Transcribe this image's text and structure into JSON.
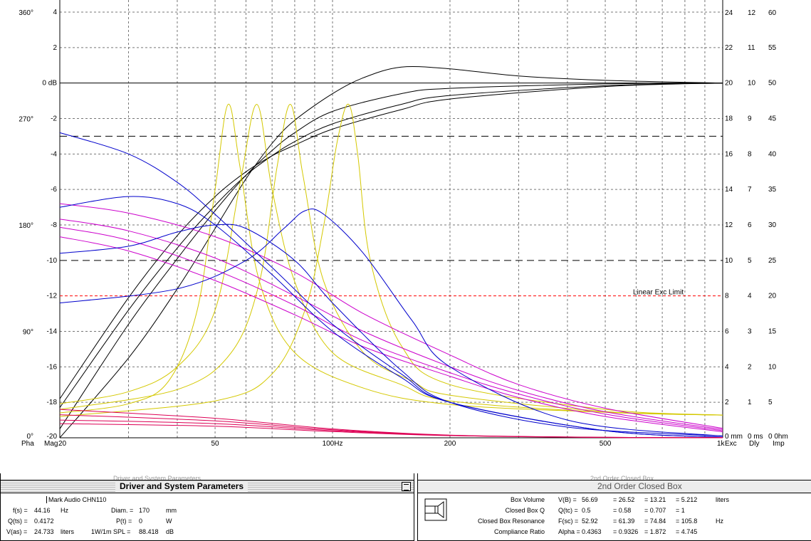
{
  "chart_data": {
    "type": "line",
    "x_scale": "log",
    "x_range": [
      20,
      1000
    ],
    "x_ticks": [
      "20",
      "50",
      "100Hz",
      "200",
      "500",
      "1k"
    ],
    "magnitude_axis": {
      "ticks": [
        "4",
        "2",
        "0 dB",
        "-2",
        "-4",
        "-6",
        "-8",
        "-10",
        "-12",
        "-14",
        "-16",
        "-18",
        "-20"
      ],
      "range": [
        -20,
        4
      ]
    },
    "phase_axis": {
      "ticks": [
        "360°",
        "270°",
        "180°",
        "90°",
        "0°"
      ],
      "range": [
        0,
        360
      ]
    },
    "right_axes": {
      "excursion": [
        "24",
        "22",
        "20",
        "18",
        "16",
        "14",
        "12",
        "10",
        "8",
        "6",
        "4",
        "2",
        "0 mm"
      ],
      "delay": [
        "12",
        "11",
        "10",
        "9",
        "8",
        "7",
        "6",
        "5",
        "4",
        "3",
        "2",
        "1",
        "0 ms"
      ],
      "impedance": [
        "60",
        "55",
        "50",
        "45",
        "40",
        "35",
        "30",
        "25",
        "20",
        "15",
        "10",
        "5",
        "0 0hm"
      ]
    },
    "axis_tags": {
      "phase": "Pha",
      "magnitude": "Mag",
      "excursion": "Exc",
      "delay": "Dly",
      "impedance": "Imp"
    },
    "reference_lines": [
      {
        "db": -3,
        "style": "dashed",
        "color": "#000000"
      },
      {
        "db": -10,
        "style": "dashed",
        "color": "#000000"
      },
      {
        "db": -12,
        "style": "dashed",
        "color": "#ff0000",
        "label": "Linear Exc Limit",
        "label_color": "#cc0033"
      }
    ],
    "series": [
      {
        "kind": "magnitude",
        "color": "#000000",
        "points": [
          [
            20,
            -20
          ],
          [
            30,
            -15.5
          ],
          [
            40,
            -11.6
          ],
          [
            50,
            -8.2
          ],
          [
            60,
            -5.4
          ],
          [
            70,
            -3.4
          ],
          [
            80,
            -2.1
          ],
          [
            100,
            -0.6
          ],
          [
            120,
            0.3
          ],
          [
            150,
            0.9
          ],
          [
            200,
            0.8
          ],
          [
            300,
            0.4
          ],
          [
            500,
            0.15
          ],
          [
            1000,
            0
          ]
        ]
      },
      {
        "kind": "magnitude",
        "color": "#000000",
        "points": [
          [
            20,
            -19.5
          ],
          [
            30,
            -13.6
          ],
          [
            40,
            -9.9
          ],
          [
            50,
            -7.2
          ],
          [
            60,
            -5.2
          ],
          [
            70,
            -3.8
          ],
          [
            80,
            -2.8
          ],
          [
            100,
            -1.6
          ],
          [
            150,
            -0.6
          ],
          [
            200,
            -0.3
          ],
          [
            500,
            -0.05
          ],
          [
            1000,
            0
          ]
        ]
      },
      {
        "kind": "magnitude",
        "color": "#000000",
        "points": [
          [
            20,
            -18.3
          ],
          [
            30,
            -12.8
          ],
          [
            40,
            -9.3
          ],
          [
            50,
            -6.9
          ],
          [
            60,
            -5.2
          ],
          [
            70,
            -4.1
          ],
          [
            80,
            -3.3
          ],
          [
            100,
            -2.3
          ],
          [
            150,
            -1.2
          ],
          [
            200,
            -0.7
          ],
          [
            500,
            -0.15
          ],
          [
            1000,
            0
          ]
        ]
      },
      {
        "kind": "magnitude",
        "color": "#000000",
        "points": [
          [
            20,
            -17.8
          ],
          [
            30,
            -12.1
          ],
          [
            40,
            -8.6
          ],
          [
            50,
            -6.4
          ],
          [
            60,
            -5.0
          ],
          [
            70,
            -4.1
          ],
          [
            80,
            -3.5
          ],
          [
            100,
            -2.6
          ],
          [
            150,
            -1.5
          ],
          [
            200,
            -0.9
          ],
          [
            500,
            -0.2
          ],
          [
            1000,
            0
          ]
        ]
      },
      {
        "kind": "impedance",
        "color": "#d4c800",
        "points": [
          [
            20,
            3.5
          ],
          [
            30,
            4.8
          ],
          [
            38,
            8
          ],
          [
            45,
            18
          ],
          [
            50,
            35
          ],
          [
            54,
            47
          ],
          [
            58,
            38
          ],
          [
            65,
            22
          ],
          [
            80,
            12
          ],
          [
            120,
            7
          ],
          [
            200,
            4.7
          ],
          [
            500,
            3.6
          ],
          [
            1000,
            3.2
          ]
        ]
      },
      {
        "kind": "impedance",
        "color": "#d4c800",
        "points": [
          [
            20,
            4.8
          ],
          [
            30,
            6.5
          ],
          [
            40,
            10
          ],
          [
            50,
            18
          ],
          [
            58,
            36
          ],
          [
            64,
            47
          ],
          [
            70,
            35
          ],
          [
            80,
            22
          ],
          [
            100,
            12
          ],
          [
            150,
            7.5
          ],
          [
            200,
            5.2
          ],
          [
            500,
            3.6
          ],
          [
            1000,
            3.2
          ]
        ]
      },
      {
        "kind": "impedance",
        "color": "#d4c800",
        "points": [
          [
            20,
            4.0
          ],
          [
            40,
            6.8
          ],
          [
            55,
            12
          ],
          [
            65,
            22
          ],
          [
            72,
            38
          ],
          [
            78,
            47
          ],
          [
            84,
            37
          ],
          [
            95,
            22
          ],
          [
            120,
            12
          ],
          [
            160,
            8
          ],
          [
            200,
            6
          ],
          [
            500,
            3.7
          ],
          [
            1000,
            3.2
          ]
        ]
      },
      {
        "kind": "impedance",
        "color": "#d4c800",
        "points": [
          [
            20,
            3.0
          ],
          [
            50,
            5.2
          ],
          [
            70,
            9
          ],
          [
            85,
            18
          ],
          [
            95,
            30
          ],
          [
            103,
            42
          ],
          [
            110,
            47
          ],
          [
            116,
            40
          ],
          [
            125,
            25
          ],
          [
            150,
            13
          ],
          [
            200,
            7.5
          ],
          [
            500,
            4.0
          ],
          [
            1000,
            3.2
          ]
        ]
      },
      {
        "kind": "phase",
        "color": "#cc00cc",
        "points": [
          [
            20,
            198
          ],
          [
            30,
            190
          ],
          [
            50,
            170
          ],
          [
            80,
            140
          ],
          [
            120,
            105
          ],
          [
            200,
            70
          ],
          [
            300,
            45
          ],
          [
            500,
            25
          ],
          [
            1000,
            8
          ]
        ]
      },
      {
        "kind": "phase",
        "color": "#cc00cc",
        "points": [
          [
            20,
            185
          ],
          [
            30,
            175
          ],
          [
            50,
            152
          ],
          [
            80,
            120
          ],
          [
            120,
            90
          ],
          [
            200,
            60
          ],
          [
            300,
            40
          ],
          [
            500,
            22
          ],
          [
            1000,
            7
          ]
        ]
      },
      {
        "kind": "phase",
        "color": "#cc00cc",
        "points": [
          [
            20,
            178
          ],
          [
            30,
            167
          ],
          [
            50,
            142
          ],
          [
            80,
            112
          ],
          [
            120,
            82
          ],
          [
            200,
            55
          ],
          [
            300,
            37
          ],
          [
            500,
            20
          ],
          [
            1000,
            6
          ]
        ]
      },
      {
        "kind": "phase",
        "color": "#cc00cc",
        "points": [
          [
            20,
            170
          ],
          [
            30,
            158
          ],
          [
            50,
            133
          ],
          [
            80,
            104
          ],
          [
            120,
            77
          ],
          [
            200,
            52
          ],
          [
            300,
            34
          ],
          [
            500,
            18
          ],
          [
            1000,
            5
          ]
        ]
      },
      {
        "kind": "delay",
        "color": "#0000cc",
        "points": [
          [
            20,
            5.2
          ],
          [
            30,
            5.4
          ],
          [
            40,
            5.8
          ],
          [
            50,
            6.0
          ],
          [
            60,
            5.9
          ],
          [
            80,
            5.0
          ],
          [
            100,
            3.8
          ],
          [
            150,
            1.9
          ],
          [
            200,
            1.0
          ],
          [
            400,
            0.3
          ],
          [
            1000,
            0.05
          ]
        ]
      },
      {
        "kind": "delay",
        "color": "#0000cc",
        "points": [
          [
            20,
            3.8
          ],
          [
            40,
            4.2
          ],
          [
            60,
            5.0
          ],
          [
            75,
            5.9
          ],
          [
            85,
            6.4
          ],
          [
            95,
            6.3
          ],
          [
            120,
            5.2
          ],
          [
            160,
            3.3
          ],
          [
            200,
            2.0
          ],
          [
            400,
            0.5
          ],
          [
            1000,
            0.05
          ]
        ]
      },
      {
        "kind": "delay",
        "color": "#0000cc",
        "points": [
          [
            20,
            6.5
          ],
          [
            30,
            6.8
          ],
          [
            40,
            6.6
          ],
          [
            50,
            6.0
          ],
          [
            70,
            4.6
          ],
          [
            100,
            3.0
          ],
          [
            150,
            1.7
          ],
          [
            200,
            1.0
          ],
          [
            500,
            0.2
          ],
          [
            1000,
            0.02
          ]
        ]
      },
      {
        "kind": "delay",
        "color": "#0000cc",
        "points": [
          [
            20,
            8.6
          ],
          [
            30,
            8.0
          ],
          [
            40,
            7.2
          ],
          [
            50,
            6.3
          ],
          [
            70,
            4.8
          ],
          [
            100,
            3.2
          ],
          [
            150,
            1.8
          ],
          [
            200,
            1.0
          ],
          [
            500,
            0.2
          ],
          [
            1000,
            0.02
          ]
        ]
      },
      {
        "kind": "excursion",
        "color": "#dd0055",
        "points": [
          [
            20,
            1.6
          ],
          [
            50,
            1.1
          ],
          [
            100,
            0.5
          ],
          [
            200,
            0.15
          ],
          [
            500,
            0.03
          ],
          [
            1000,
            0.01
          ]
        ]
      },
      {
        "kind": "excursion",
        "color": "#dd0055",
        "points": [
          [
            20,
            1.3
          ],
          [
            50,
            0.95
          ],
          [
            100,
            0.45
          ],
          [
            200,
            0.14
          ],
          [
            500,
            0.03
          ],
          [
            1000,
            0.01
          ]
        ]
      },
      {
        "kind": "excursion",
        "color": "#dd0055",
        "points": [
          [
            20,
            1.0
          ],
          [
            50,
            0.8
          ],
          [
            100,
            0.4
          ],
          [
            200,
            0.13
          ],
          [
            500,
            0.02
          ],
          [
            1000,
            0.01
          ]
        ]
      },
      {
        "kind": "excursion",
        "color": "#dd0055",
        "points": [
          [
            20,
            0.8
          ],
          [
            50,
            0.65
          ],
          [
            100,
            0.35
          ],
          [
            200,
            0.12
          ],
          [
            500,
            0.02
          ],
          [
            1000,
            0.01
          ]
        ]
      }
    ]
  },
  "driver_panel": {
    "title": "Driver and System Parameters",
    "ghost_header": "Driver and System Parameters",
    "driver_name": "Mark Audio CHN110",
    "params": [
      {
        "label": "f(s) =",
        "value": "44.16",
        "unit": "Hz"
      },
      {
        "label": "Q(ts) =",
        "value": "0.4172",
        "unit": ""
      },
      {
        "label": "V(as) =",
        "value": "24.733",
        "unit": "liters"
      }
    ],
    "params2": [
      {
        "label": "Diam. =",
        "value": "170",
        "unit": "mm"
      },
      {
        "label": "P(t) =",
        "value": "0",
        "unit": "W"
      },
      {
        "label": "1W/1m SPL =",
        "value": "88.418",
        "unit": "dB"
      }
    ]
  },
  "box_panel": {
    "title": "2nd Order Closed Box",
    "ghost_header": "2nd Order Closed Box",
    "rows": [
      {
        "label": "Box Volume",
        "sym": "V(B) =",
        "values": [
          "56.69",
          "= 26.52",
          "= 13.21",
          "= 5.212"
        ],
        "unit": "liters"
      },
      {
        "label": "Closed Box Q",
        "sym": "Q(tc) =",
        "values": [
          "0.5",
          "= 0.58",
          "= 0.707",
          "= 1"
        ],
        "unit": ""
      },
      {
        "label": "Closed Box Resonance",
        "sym": "F(sc) =",
        "values": [
          "52.92",
          "= 61.39",
          "= 74.84",
          "= 105.8"
        ],
        "unit": "Hz"
      },
      {
        "label": "Compliance Ratio",
        "sym": "Alpha =",
        "values": [
          "0.4363",
          "= 0.9326",
          "= 1.872",
          "= 4.745"
        ],
        "unit": ""
      }
    ]
  }
}
